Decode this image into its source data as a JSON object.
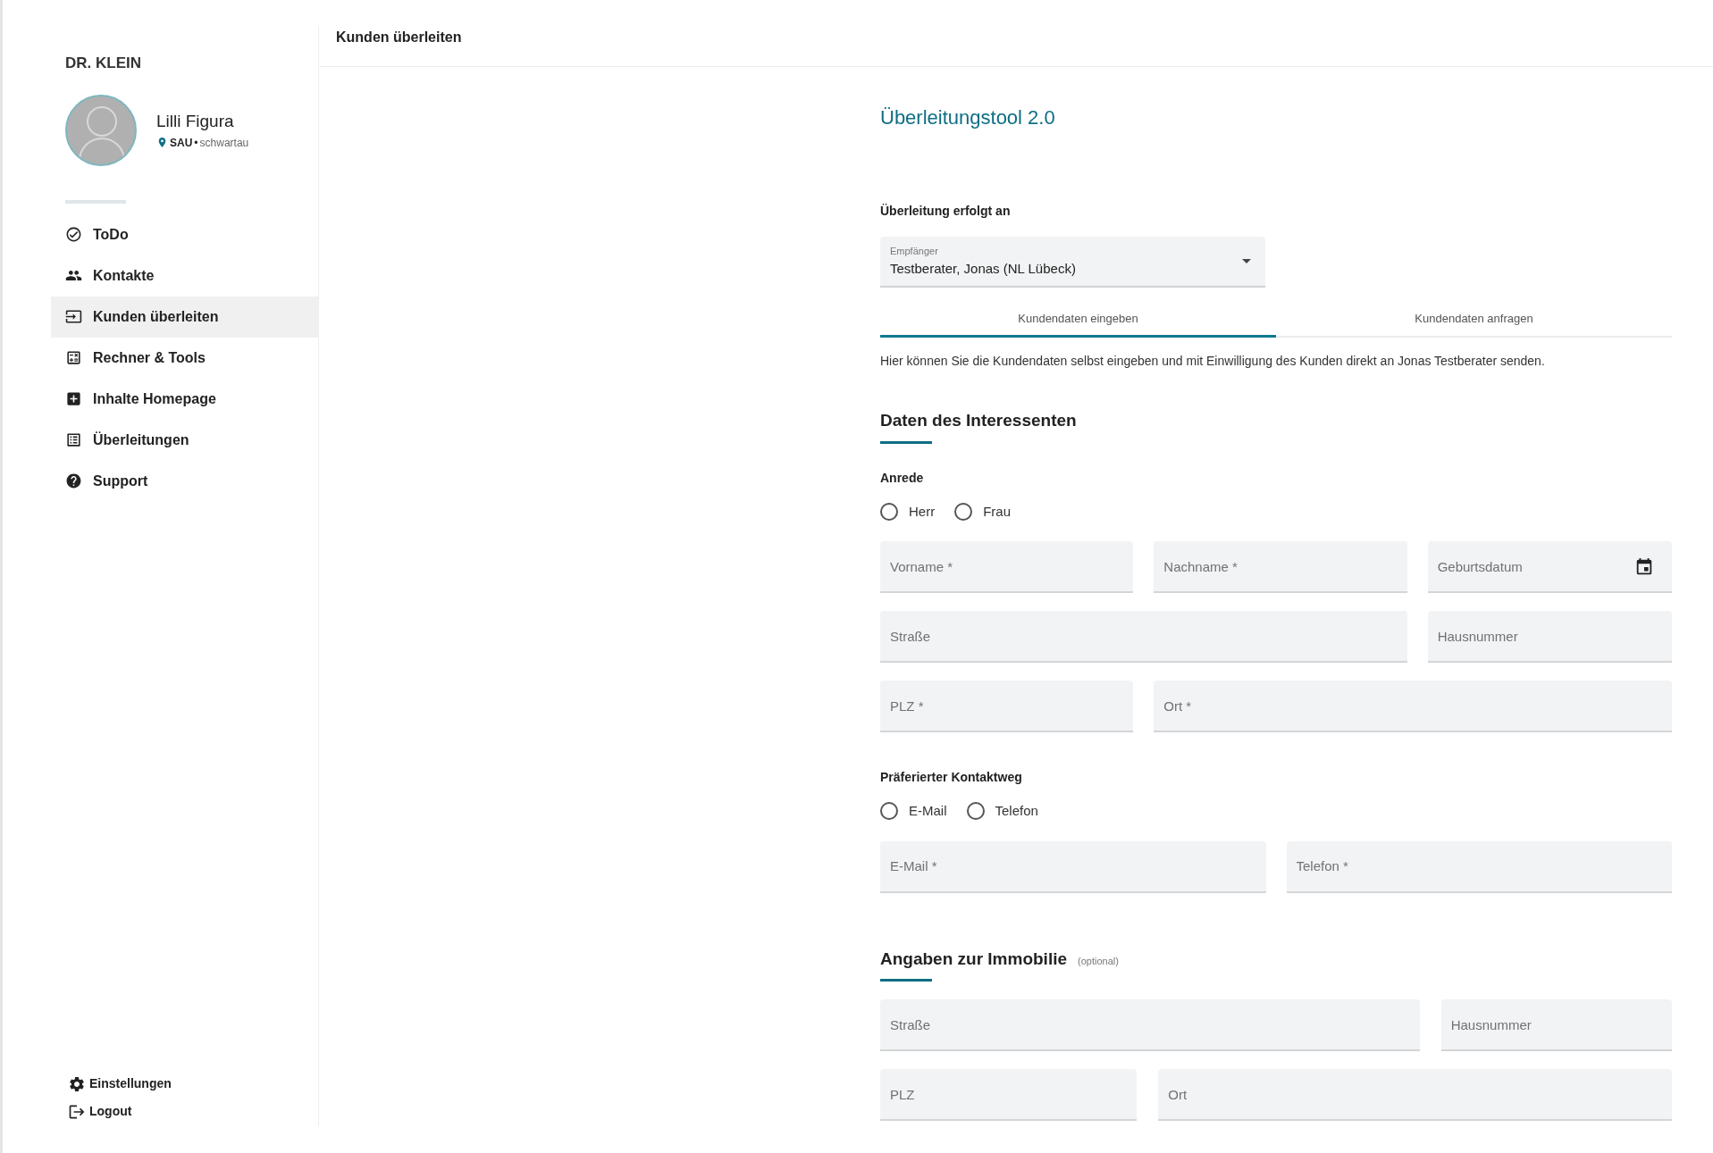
{
  "sidebar": {
    "brand": "DR. KLEIN",
    "user": {
      "name": "Lilli Figura",
      "branch": "SAU",
      "separator": "•",
      "location": "schwartau"
    },
    "items": [
      {
        "label": "ToDo",
        "selected": false
      },
      {
        "label": "Kontakte",
        "selected": false
      },
      {
        "label": "Kunden überleiten",
        "selected": true
      },
      {
        "label": "Rechner & Tools",
        "selected": false
      },
      {
        "label": "Inhalte Homepage",
        "selected": false
      },
      {
        "label": "Überleitungen",
        "selected": false
      },
      {
        "label": "Support",
        "selected": false
      }
    ],
    "footer": [
      "Einstellungen",
      "Logout"
    ]
  },
  "header": {
    "title": "Kunden überleiten"
  },
  "form": {
    "title": "Überleitungstool 2.0",
    "recipient_label": "Überleitung erfolgt an",
    "recipient": {
      "label": "Empfänger",
      "value": "Testberater, Jonas (NL Lübeck)"
    },
    "tabs": [
      {
        "label": "Kundendaten eingeben",
        "selected": true
      },
      {
        "label": "Kundendaten anfragen",
        "selected": false
      }
    ],
    "description": "Hier können Sie die Kundendaten selbst eingeben und mit Einwilligung des Kunden direkt an Jonas Testberater senden.",
    "sections": [
      {
        "title": "Daten des Interessenten",
        "blocks": [
          {
            "kind": "radio",
            "label": "Anrede",
            "options": [
              {
                "label": "Herr",
                "selected": false
              },
              {
                "label": "Frau",
                "selected": false
              }
            ]
          },
          {
            "kind": "fields",
            "fields": [
              {
                "placeholder": "Vorname *"
              },
              {
                "placeholder": "Nachname *"
              },
              {
                "placeholder": "Geburtsdatum",
                "kind": "date"
              },
              {
                "placeholder": "Straße"
              },
              {
                "placeholder": "Hausnummer"
              },
              {
                "placeholder": "PLZ *"
              },
              {
                "placeholder": "Ort *"
              }
            ]
          },
          {
            "kind": "radio",
            "label": "Präferierter Kontaktweg",
            "options": [
              {
                "label": "E-Mail",
                "selected": false
              },
              {
                "label": "Telefon",
                "selected": false
              }
            ]
          },
          {
            "kind": "fields",
            "fields": [
              {
                "placeholder": "E-Mail *"
              },
              {
                "placeholder": "Telefon *"
              }
            ]
          }
        ]
      },
      {
        "title": "Angaben zur Immobilie",
        "note": "(optional)",
        "blocks": [
          {
            "kind": "fields",
            "fields": [
              {
                "placeholder": "Straße"
              },
              {
                "placeholder": "Hausnummer"
              },
              {
                "placeholder": "PLZ"
              },
              {
                "placeholder": "Ort"
              }
            ]
          }
        ]
      }
    ]
  }
}
